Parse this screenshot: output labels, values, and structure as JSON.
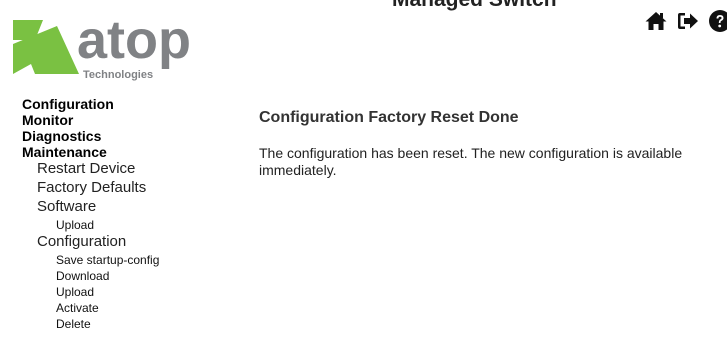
{
  "header": {
    "title": "Managed Switch",
    "logo": {
      "brand": "atop",
      "tagline": "Technologies",
      "colors": {
        "green": "#7ac142",
        "gray": "#808285"
      }
    },
    "icons": [
      "home-icon",
      "logout-icon",
      "help-icon"
    ]
  },
  "nav": {
    "configuration": "Configuration",
    "monitor": "Monitor",
    "diagnostics": "Diagnostics",
    "maintenance": {
      "label": "Maintenance",
      "restart_device": "Restart Device",
      "factory_defaults": "Factory Defaults",
      "software": {
        "label": "Software",
        "upload": "Upload"
      },
      "configuration": {
        "label": "Configuration",
        "save_startup_config": "Save startup-config",
        "download": "Download",
        "upload": "Upload",
        "activate": "Activate",
        "delete": "Delete"
      }
    }
  },
  "main": {
    "heading": "Configuration Factory Reset Done",
    "message": "The configuration has been reset. The new configuration is available immediately."
  }
}
